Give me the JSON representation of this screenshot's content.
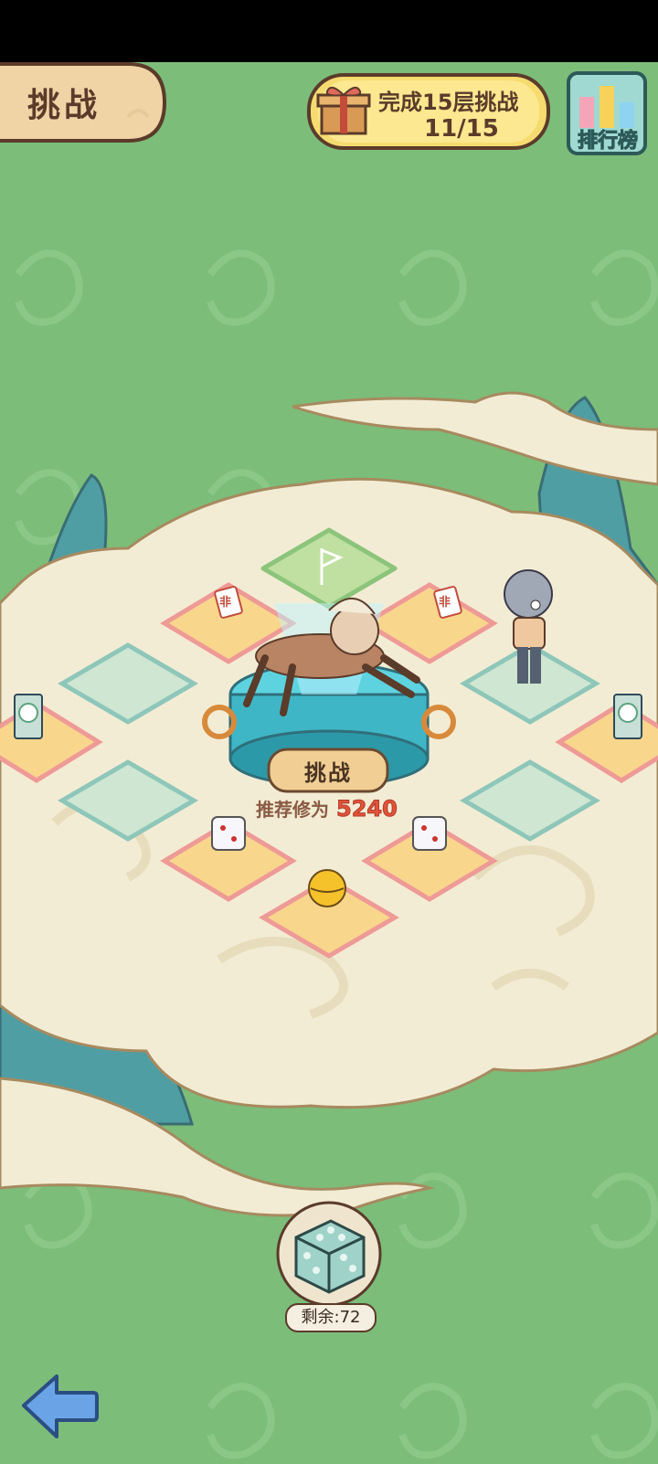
{
  "header": {
    "title": "挑战",
    "task_text": "完成15层挑战",
    "task_progress": "11/15",
    "leaderboard_label": "排行榜"
  },
  "board": {
    "challenge_button": "挑战",
    "recommend_label": "推荐修为",
    "recommend_value": "5240",
    "tile_cards": [
      "非",
      "非"
    ]
  },
  "dice": {
    "remaining_text": "剩余:72"
  },
  "icons": [
    "gift-icon",
    "leaderboard-icon",
    "flag-icon",
    "card-icon",
    "dice-icon",
    "ball-icon",
    "back-arrow-icon"
  ],
  "colors": {
    "background": "#7cbd7a",
    "tile_green": "#bfe0c4",
    "tile_pink": "#ee9a96",
    "tile_yellow": "#f8d68c",
    "cloud": "#f3ecd5",
    "accent_red": "#e2533b"
  }
}
